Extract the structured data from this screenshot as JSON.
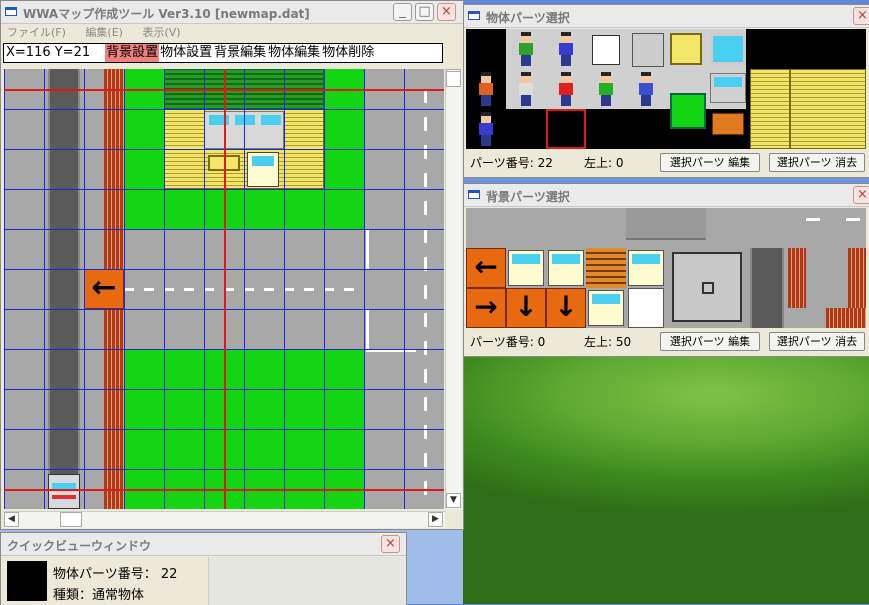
{
  "main_window": {
    "title": "WWAマップ作成ツール Ver3.10 [newmap.dat]",
    "menu": [
      "ファイル(F)",
      "編集(E)",
      "表示(V)"
    ],
    "toolbar": {
      "coords": "X=116 Y=21",
      "modes": [
        "背景設置",
        "物体設置",
        "背景編集",
        "物体編集",
        "物体削除"
      ],
      "active_mode": "背景設置"
    },
    "controls": {
      "minimize": "_",
      "maximize": "□",
      "close": "×"
    }
  },
  "object_parts_window": {
    "title": "物体パーツ選択",
    "part_number_label": "パーツ番号: 22",
    "top_left_label": "左上: 0",
    "edit_button": "選択パーツ 編集",
    "delete_button": "選択パーツ 消去",
    "close": "×",
    "selected_index": 22
  },
  "bg_parts_window": {
    "title": "背景パーツ選択",
    "part_number_label": "パーツ番号: 0",
    "top_left_label": "左上: 50",
    "edit_button": "選択パーツ 編集",
    "delete_button": "選択パーツ 消去",
    "close": "×"
  },
  "quickview_window": {
    "title": "クイックビューウィンドウ",
    "part_line": "物体パーツ番号： 22",
    "type_line": "種類：通常物体",
    "close": "×"
  },
  "colors": {
    "grass": "#14d514",
    "road": "#a8a8a8",
    "grid": "#1a2bd6",
    "marker": "#e01818",
    "active": "#f08080"
  }
}
